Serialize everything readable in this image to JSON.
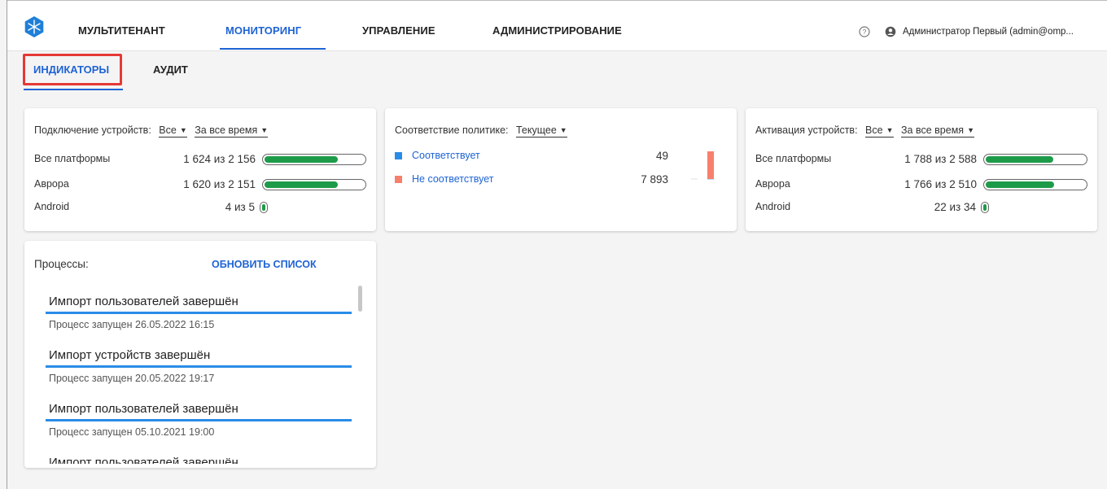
{
  "nav": {
    "items": [
      "МУЛЬТИТЕНАНТ",
      "МОНИТОРИНГ",
      "УПРАВЛЕНИЕ",
      "АДМИНИСТРИРОВАНИЕ"
    ],
    "active": "МОНИТОРИНГ",
    "user": "Администратор Первый (admin@omp..."
  },
  "subtabs": {
    "items": [
      "ИНДИКАТОРЫ",
      "АУДИТ"
    ],
    "active": "ИНДИКАТОРЫ"
  },
  "connection_card": {
    "title": "Подключение устройств:",
    "filter_platform": "Все",
    "filter_period": "За все время",
    "rows": [
      {
        "label": "Все платформы",
        "value": "1 624 из 2 156",
        "fraction": 0.753
      },
      {
        "label": "Аврора",
        "value": "1 620 из 2 151",
        "fraction": 0.753
      },
      {
        "label": "Android",
        "value": "4 из 5",
        "fraction": 0.8
      }
    ]
  },
  "policy_card": {
    "title": "Соответствие политике:",
    "filter": "Текущее",
    "items": [
      {
        "label": "Соответствует",
        "value": "49",
        "color": "#2a8ce6"
      },
      {
        "label": "Не соответствует",
        "value": "7 893",
        "color": "#f7806c"
      }
    ]
  },
  "activation_card": {
    "title": "Активация устройств:",
    "filter_platform": "Все",
    "filter_period": "За все время",
    "rows": [
      {
        "label": "Все платформы",
        "value": "1 788 из 2 588",
        "fraction": 0.691
      },
      {
        "label": "Аврора",
        "value": "1 766 из 2 510",
        "fraction": 0.704
      },
      {
        "label": "Android",
        "value": "22 из 34",
        "fraction": 0.647
      }
    ]
  },
  "processes": {
    "title": "Процессы:",
    "refresh_label": "ОБНОВИТЬ СПИСОК",
    "items": [
      {
        "name": "Импорт пользователей завершён",
        "started": "Процесс запущен 26.05.2022 16:15"
      },
      {
        "name": "Импорт устройств завершён",
        "started": "Процесс запущен 20.05.2022 19:17"
      },
      {
        "name": "Импорт пользователей завершён",
        "started": "Процесс запущен 05.10.2021 19:00"
      },
      {
        "name": "Импорт пользователей завершён",
        "started": ""
      }
    ]
  },
  "colors": {
    "accent": "#1e63d5",
    "progress_green": "#1e9b49",
    "process_bar": "#2a8ce6",
    "highlight_red": "#e53935"
  }
}
